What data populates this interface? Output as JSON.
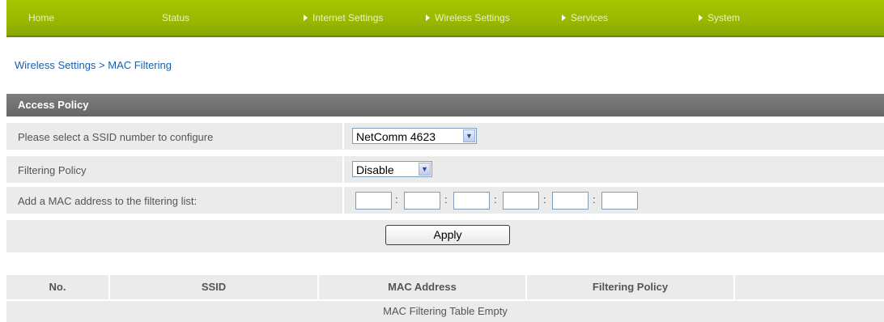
{
  "nav": {
    "items": [
      {
        "label": "Home",
        "has_arrow": false
      },
      {
        "label": "Status",
        "has_arrow": false
      },
      {
        "label": "Internet Settings",
        "has_arrow": true
      },
      {
        "label": "Wireless Settings",
        "has_arrow": true
      },
      {
        "label": "Services",
        "has_arrow": true
      },
      {
        "label": "System",
        "has_arrow": true
      }
    ],
    "color": "#9cbb00"
  },
  "breadcrumb": "Wireless Settings > MAC Filtering",
  "access_policy": {
    "title": "Access Policy",
    "ssid_label": "Please select a SSID number to configure",
    "ssid_value": "NetComm 4623",
    "policy_label": "Filtering Policy",
    "policy_value": "Disable",
    "mac_label": "Add a MAC address to the filtering list:",
    "mac_fields": [
      "",
      "",
      "",
      "",
      "",
      ""
    ],
    "mac_separator": ":",
    "apply_label": "Apply"
  },
  "table": {
    "headers": [
      "No.",
      "SSID",
      "MAC Address",
      "Filtering Policy",
      ""
    ],
    "empty_message": "MAC Filtering Table Empty"
  }
}
